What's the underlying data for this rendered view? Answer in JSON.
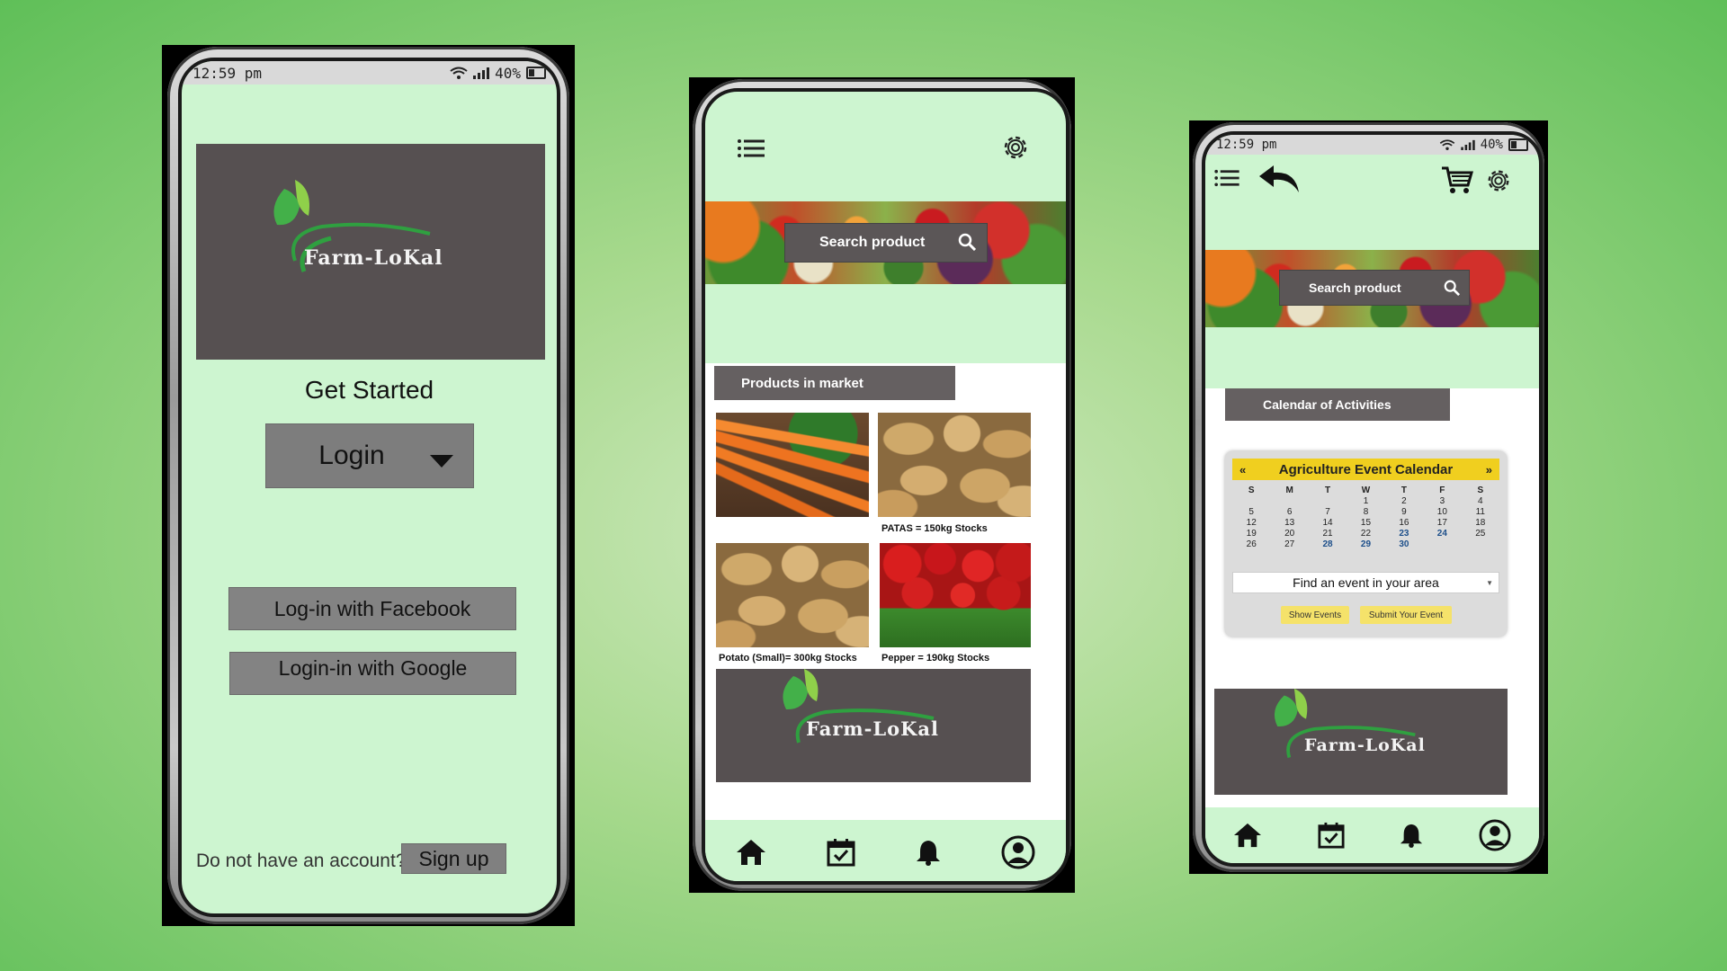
{
  "colors": {
    "screen_bg": "#cdf5d0",
    "dark_gray": "#565051",
    "button_gray": "#7d7d7d",
    "calendar_yellow": "#f0cf1f",
    "highlight_date": "#1d4f8a"
  },
  "phone1": {
    "status": {
      "time": "12:59 pm",
      "battery": "40%"
    },
    "logo": "Farm-LoKal",
    "get_started": "Get Started",
    "login_dropdown": "Login",
    "facebook_btn": "Log-in with Facebook",
    "google_btn": "Login-in with Google",
    "no_account": "Do not have an account?",
    "signup_btn": "Sign up"
  },
  "phone2": {
    "search_label": "Search product",
    "section_title": "Products in market",
    "products": [
      {
        "caption": ""
      },
      {
        "caption": "PATAS =  150kg Stocks"
      },
      {
        "caption": "Potato (Small)= 300kg Stocks"
      },
      {
        "caption": "Pepper =  190kg Stocks"
      }
    ],
    "logo": "Farm-LoKal",
    "icons": [
      "menu-icon",
      "gear-icon",
      "home-icon",
      "calendar-icon",
      "bell-icon",
      "user-icon"
    ]
  },
  "phone3": {
    "status": {
      "time": "12:59 pm",
      "battery": "40%"
    },
    "search_label": "Search product",
    "section_title": "Calendar of Activities",
    "calendar": {
      "prev": "«",
      "title": "Agriculture Event Calendar",
      "next": "»",
      "day_headers": [
        "S",
        "M",
        "T",
        "W",
        "T",
        "F",
        "S"
      ],
      "weeks": [
        [
          "",
          "",
          "",
          "1",
          "2",
          "3",
          "4"
        ],
        [
          "5",
          "6",
          "7",
          "8",
          "9",
          "10",
          "11"
        ],
        [
          "12",
          "13",
          "14",
          "15",
          "16",
          "17",
          "18"
        ],
        [
          "19",
          "20",
          "21",
          "22",
          "23",
          "24",
          "25"
        ],
        [
          "26",
          "27",
          "28",
          "29",
          "30",
          "",
          ""
        ]
      ],
      "highlighted": [
        "23",
        "24",
        "28",
        "29",
        "30"
      ],
      "select_value": "Find an event in your area",
      "show_events_btn": "Show Events",
      "submit_event_btn": "Submit Your Event"
    },
    "logo": "Farm-LoKal"
  }
}
